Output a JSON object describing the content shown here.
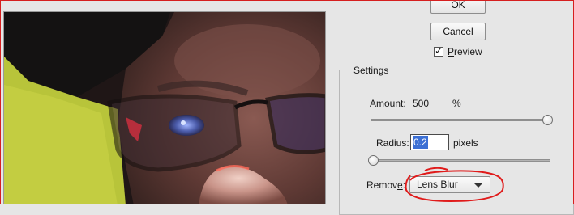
{
  "buttons": {
    "ok": "OK",
    "cancel": "Cancel"
  },
  "preview": {
    "checked": true,
    "check_mark": "✓",
    "label_prefix": "",
    "label_underlined": "P",
    "label_rest": "review"
  },
  "settings": {
    "legend": "Settings",
    "amount": {
      "label": "Amount:",
      "value": "500",
      "unit": "%",
      "level": 1.0
    },
    "radius": {
      "label": "Radius:",
      "value": "0.2",
      "unit": "pixels",
      "level": 0.0
    },
    "remove": {
      "label_prefix": "Remov",
      "label_underlined": "e",
      "label_suffix": ":",
      "selected": "Lens Blur"
    }
  },
  "colors": {
    "annotation": "#e01b1b",
    "selection": "#3b6fd4"
  }
}
